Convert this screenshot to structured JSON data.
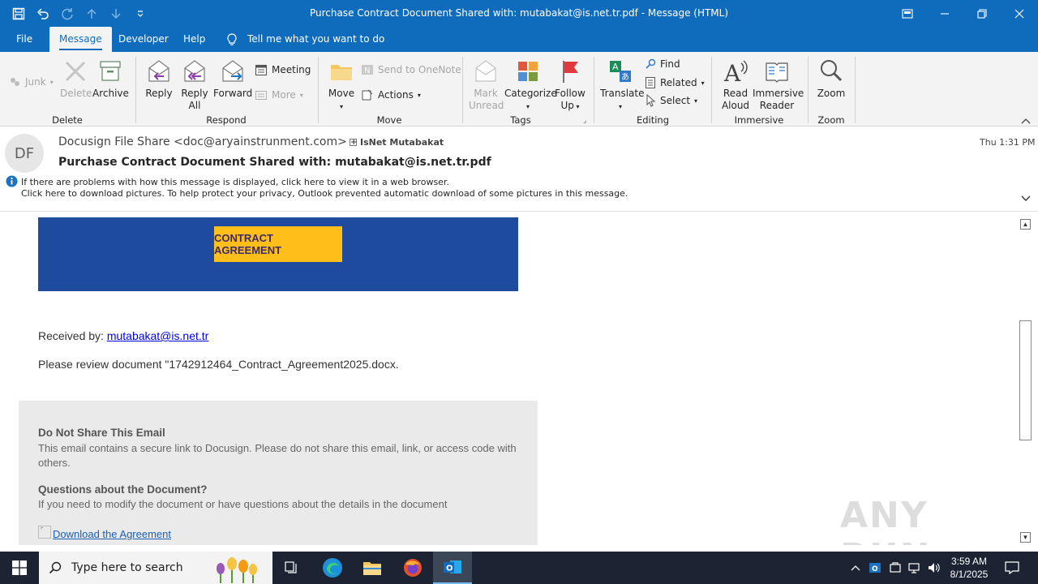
{
  "window": {
    "title": "Purchase Contract Document Shared with: mutabakat@is.net.tr.pdf  -  Message (HTML)"
  },
  "tabs": [
    "File",
    "Message",
    "Developer",
    "Help"
  ],
  "tell_me": "Tell me what you want to do",
  "ribbon": {
    "delete_group": {
      "junk": "Junk",
      "delete": "Delete",
      "archive": "Archive",
      "label": "Delete"
    },
    "respond_group": {
      "reply": "Reply",
      "reply_all_1": "Reply",
      "reply_all_2": "All",
      "forward": "Forward",
      "meeting": "Meeting",
      "more": "More",
      "label": "Respond"
    },
    "move_group": {
      "move": "Move",
      "send_onenote": "Send to OneNote",
      "actions": "Actions",
      "label": "Move"
    },
    "tags_group": {
      "mark_unread_1": "Mark",
      "mark_unread_2": "Unread",
      "categorize": "Categorize",
      "follow_up_1": "Follow",
      "follow_up_2": "Up",
      "label": "Tags"
    },
    "editing_group": {
      "translate": "Translate",
      "find": "Find",
      "related": "Related",
      "select": "Select",
      "label": "Editing"
    },
    "immersive_group": {
      "read_aloud_1": "Read",
      "read_aloud_2": "Aloud",
      "immersive_reader_1": "Immersive",
      "immersive_reader_2": "Reader",
      "label": "Immersive"
    },
    "zoom_group": {
      "zoom": "Zoom",
      "label": "Zoom"
    }
  },
  "header": {
    "avatar_initials": "DF",
    "from": "Docusign File Share <doc@aryainstrunment.com>",
    "to": "IsNet Mutabakat",
    "time": "Thu 1:31 PM",
    "subject": "Purchase Contract Document Shared with: mutabakat@is.net.tr.pdf",
    "info_line1": "If there are problems with how this message is displayed, click here to view it in a web browser.",
    "info_line2": "Click here to download pictures. To help protect your privacy, Outlook prevented automatic download of some pictures in this message."
  },
  "body": {
    "cta": "CONTRACT AGREEMENT",
    "received_label": "Received by: ",
    "received_email": "mutabakat@is.net.tr",
    "review_text": "Please review document \"1742912464_Contract_Agreement2025.docx.",
    "dns_title": "Do Not Share This Email",
    "dns_text": "This email contains a secure link to Docusign. Please do not share this email, link, or access code with others.",
    "q_title": "Questions about the Document?",
    "q_text": "If you need to modify the document or have questions about the details in the document",
    "download_link": "Download the Agreement"
  },
  "watermark": "ANY RUN",
  "taskbar": {
    "search_placeholder": "Type here to search",
    "time": "3:59 AM",
    "date": "8/1/2025"
  },
  "colors": {
    "accent": "#0f6cbd",
    "banner": "#1e4b9e",
    "cta": "#ffbe1a",
    "link": "#0000ee"
  }
}
